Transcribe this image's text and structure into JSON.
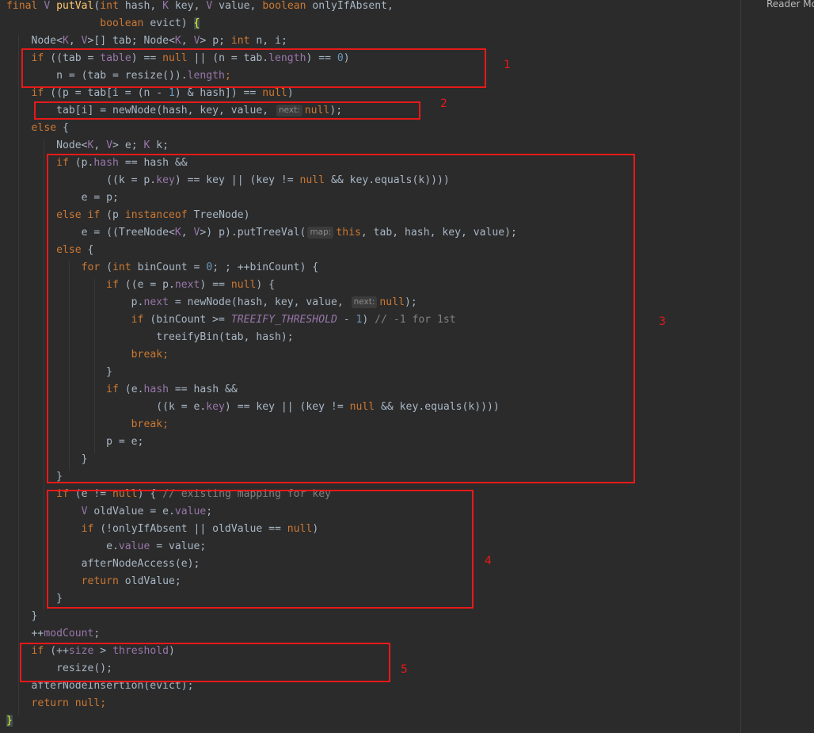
{
  "right_panel": {
    "reader_mode_label": "Reader Mo"
  },
  "code": {
    "lines": [
      [
        {
          "t": "final",
          "c": "kw"
        },
        {
          "t": " "
        },
        {
          "t": "V",
          "c": "tp"
        },
        {
          "t": " "
        },
        {
          "t": "putVal",
          "c": "fn"
        },
        {
          "t": "("
        },
        {
          "t": "int",
          "c": "kw"
        },
        {
          "t": " hash, "
        },
        {
          "t": "K",
          "c": "tp"
        },
        {
          "t": " key, "
        },
        {
          "t": "V",
          "c": "tp"
        },
        {
          "t": " value, "
        },
        {
          "t": "boolean",
          "c": "kw"
        },
        {
          "t": " onlyIfAbsent,"
        }
      ],
      [
        {
          "t": "               "
        },
        {
          "t": "boolean",
          "c": "kw"
        },
        {
          "t": " evict) "
        },
        {
          "t": "{",
          "c": "brace"
        }
      ],
      [
        {
          "t": "    Node<"
        },
        {
          "t": "K",
          "c": "tp"
        },
        {
          "t": ", "
        },
        {
          "t": "V",
          "c": "tp"
        },
        {
          "t": ">[] tab; Node<"
        },
        {
          "t": "K",
          "c": "tp"
        },
        {
          "t": ", "
        },
        {
          "t": "V",
          "c": "tp"
        },
        {
          "t": "> p; "
        },
        {
          "t": "int",
          "c": "kw"
        },
        {
          "t": " n, i;"
        }
      ],
      [
        {
          "t": "    "
        },
        {
          "t": "if",
          "c": "kw"
        },
        {
          "t": " ((tab = "
        },
        {
          "t": "table",
          "c": "fld"
        },
        {
          "t": ") == "
        },
        {
          "t": "null",
          "c": "kw"
        },
        {
          "t": " || (n = tab."
        },
        {
          "t": "length",
          "c": "fld"
        },
        {
          "t": ") == "
        },
        {
          "t": "0",
          "c": "num"
        },
        {
          "t": ")"
        }
      ],
      [
        {
          "t": "        n = (tab = resize())."
        },
        {
          "t": "length",
          "c": "fld"
        },
        {
          "t": ";",
          "c": "kw"
        }
      ],
      [
        {
          "t": "    "
        },
        {
          "t": "if",
          "c": "kw"
        },
        {
          "t": " ((p = tab[i = (n - "
        },
        {
          "t": "1",
          "c": "num"
        },
        {
          "t": ") & hash]) == "
        },
        {
          "t": "null",
          "c": "kw"
        },
        {
          "t": ")"
        }
      ],
      [
        {
          "t": "        tab[i] = newNode(hash, key, value, "
        },
        {
          "t": "next:",
          "c": "hint"
        },
        {
          "t": "null",
          "c": "kw"
        },
        {
          "t": ");"
        }
      ],
      [
        {
          "t": "    "
        },
        {
          "t": "else",
          "c": "kw"
        },
        {
          "t": " {"
        }
      ],
      [
        {
          "t": "        Node<"
        },
        {
          "t": "K",
          "c": "tp"
        },
        {
          "t": ", "
        },
        {
          "t": "V",
          "c": "tp"
        },
        {
          "t": "> e; "
        },
        {
          "t": "K",
          "c": "tp"
        },
        {
          "t": " k;"
        }
      ],
      [
        {
          "t": "        "
        },
        {
          "t": "if",
          "c": "kw"
        },
        {
          "t": " (p."
        },
        {
          "t": "hash",
          "c": "fld"
        },
        {
          "t": " == hash &&"
        }
      ],
      [
        {
          "t": "                ((k = p."
        },
        {
          "t": "key",
          "c": "fld"
        },
        {
          "t": ") == key || (key != "
        },
        {
          "t": "null",
          "c": "kw"
        },
        {
          "t": " && key.equals(k))))"
        }
      ],
      [
        {
          "t": "            e = p;"
        }
      ],
      [
        {
          "t": "        "
        },
        {
          "t": "else if",
          "c": "kw"
        },
        {
          "t": " (p "
        },
        {
          "t": "instanceof",
          "c": "kw"
        },
        {
          "t": " TreeNode)"
        }
      ],
      [
        {
          "t": "            e = ((TreeNode<"
        },
        {
          "t": "K",
          "c": "tp"
        },
        {
          "t": ", "
        },
        {
          "t": "V",
          "c": "tp"
        },
        {
          "t": ">) p).putTreeVal("
        },
        {
          "t": "map:",
          "c": "hint"
        },
        {
          "t": "this",
          "c": "kw"
        },
        {
          "t": ", tab, hash, key, value);"
        }
      ],
      [
        {
          "t": "        "
        },
        {
          "t": "else",
          "c": "kw"
        },
        {
          "t": " {"
        }
      ],
      [
        {
          "t": "            "
        },
        {
          "t": "for",
          "c": "kw"
        },
        {
          "t": " ("
        },
        {
          "t": "int",
          "c": "kw"
        },
        {
          "t": " binCount = "
        },
        {
          "t": "0",
          "c": "num"
        },
        {
          "t": "; ; ++binCount) {"
        }
      ],
      [
        {
          "t": "                "
        },
        {
          "t": "if",
          "c": "kw"
        },
        {
          "t": " ((e = p."
        },
        {
          "t": "next",
          "c": "fld"
        },
        {
          "t": ") == "
        },
        {
          "t": "null",
          "c": "kw"
        },
        {
          "t": ") {"
        }
      ],
      [
        {
          "t": "                    p."
        },
        {
          "t": "next",
          "c": "fld"
        },
        {
          "t": " = newNode(hash, key, value, "
        },
        {
          "t": "next:",
          "c": "hint"
        },
        {
          "t": "null",
          "c": "kw"
        },
        {
          "t": ");"
        }
      ],
      [
        {
          "t": "                    "
        },
        {
          "t": "if",
          "c": "kw"
        },
        {
          "t": " (binCount >= "
        },
        {
          "t": "TREEIFY_THRESHOLD",
          "c": "cst"
        },
        {
          "t": " - "
        },
        {
          "t": "1",
          "c": "num"
        },
        {
          "t": ") "
        },
        {
          "t": "// -1 for 1st",
          "c": "cmt"
        }
      ],
      [
        {
          "t": "                        treeifyBin(tab, hash);"
        }
      ],
      [
        {
          "t": "                    "
        },
        {
          "t": "break;",
          "c": "kw"
        }
      ],
      [
        {
          "t": "                }"
        }
      ],
      [
        {
          "t": "                "
        },
        {
          "t": "if",
          "c": "kw"
        },
        {
          "t": " (e."
        },
        {
          "t": "hash",
          "c": "fld"
        },
        {
          "t": " == hash &&"
        }
      ],
      [
        {
          "t": "                        ((k = e."
        },
        {
          "t": "key",
          "c": "fld"
        },
        {
          "t": ") == key || (key != "
        },
        {
          "t": "null",
          "c": "kw"
        },
        {
          "t": " && key.equals(k))))"
        }
      ],
      [
        {
          "t": "                    "
        },
        {
          "t": "break;",
          "c": "kw"
        }
      ],
      [
        {
          "t": "                p = e;"
        }
      ],
      [
        {
          "t": "            }"
        }
      ],
      [
        {
          "t": "        }"
        }
      ],
      [
        {
          "t": "        "
        },
        {
          "t": "if",
          "c": "kw"
        },
        {
          "t": " (e != "
        },
        {
          "t": "null",
          "c": "kw"
        },
        {
          "t": ") { "
        },
        {
          "t": "// existing mapping for key",
          "c": "cmt"
        }
      ],
      [
        {
          "t": "            "
        },
        {
          "t": "V",
          "c": "tp"
        },
        {
          "t": " oldValue = e."
        },
        {
          "t": "value",
          "c": "fld"
        },
        {
          "t": ";"
        }
      ],
      [
        {
          "t": "            "
        },
        {
          "t": "if",
          "c": "kw"
        },
        {
          "t": " (!onlyIfAbsent || oldValue == "
        },
        {
          "t": "null",
          "c": "kw"
        },
        {
          "t": ")"
        }
      ],
      [
        {
          "t": "                e."
        },
        {
          "t": "value",
          "c": "fld"
        },
        {
          "t": " = value;"
        }
      ],
      [
        {
          "t": "            afterNodeAccess(e);"
        }
      ],
      [
        {
          "t": "            "
        },
        {
          "t": "return",
          "c": "kw"
        },
        {
          "t": " oldValue;"
        }
      ],
      [
        {
          "t": "        }"
        }
      ],
      [
        {
          "t": "    }"
        }
      ],
      [
        {
          "t": "    ++"
        },
        {
          "t": "modCount",
          "c": "fld"
        },
        {
          "t": ";"
        }
      ],
      [
        {
          "t": "    "
        },
        {
          "t": "if",
          "c": "kw"
        },
        {
          "t": " (++"
        },
        {
          "t": "size",
          "c": "fld"
        },
        {
          "t": " > "
        },
        {
          "t": "threshold",
          "c": "fld"
        },
        {
          "t": ")"
        }
      ],
      [
        {
          "t": "        resize();"
        }
      ],
      [
        {
          "t": "    afterNodeInsertion(evict);"
        }
      ],
      [
        {
          "t": "    "
        },
        {
          "t": "return null;",
          "c": "kw"
        }
      ],
      [
        {
          "t": "}",
          "c": "brace"
        }
      ]
    ]
  },
  "annotations": [
    {
      "label": "1"
    },
    {
      "label": "2"
    },
    {
      "label": "3"
    },
    {
      "label": "4"
    },
    {
      "label": "5"
    }
  ]
}
